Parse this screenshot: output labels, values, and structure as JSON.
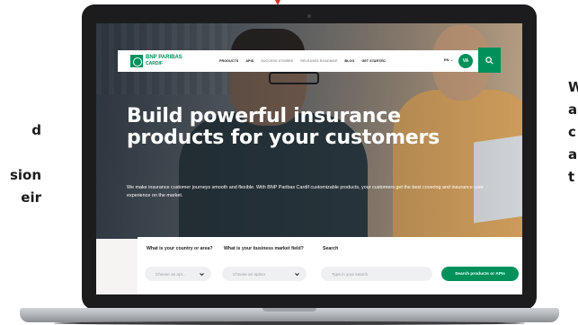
{
  "side_text": {
    "left_lines": [
      "d",
      "",
      "sion",
      "eir"
    ],
    "right_lines": [
      "W",
      "a",
      "c",
      "a",
      "t"
    ]
  },
  "site": {
    "logo": {
      "line1": "BNP PARIBAS",
      "line2": "CARDIF"
    },
    "nav": {
      "items": [
        {
          "label": "PRODUCTS",
          "muted": false
        },
        {
          "label": "APIS",
          "muted": false
        },
        {
          "label": "SUCCESS STORIES",
          "muted": true
        },
        {
          "label": "RELEASES ROADMAP",
          "muted": true
        },
        {
          "label": "BLOG",
          "muted": false
        },
        {
          "label": "GET STARTED",
          "muted": false
        }
      ],
      "language": "EN",
      "avatar_initials": "VA"
    },
    "hero": {
      "title_line1": "Build powerful insurance",
      "title_line2": "products for your customers",
      "description": "We make insurance customer journeys smooth and flexible. With BNP Paribas Cardif customizable products, your customers get the best covering and insurance user experience on the market."
    },
    "search": {
      "country_label": "What is your country or area?",
      "country_placeholder": "Choose an opt...",
      "market_label": "What is your business market field?",
      "market_placeholder": "Choose an option",
      "search_label": "Search",
      "search_placeholder": "Type in your search",
      "submit_label": "Search products or APIs"
    }
  },
  "colors": {
    "brand": "#00915a",
    "title": "#ffffff",
    "background": "#ffffff"
  }
}
